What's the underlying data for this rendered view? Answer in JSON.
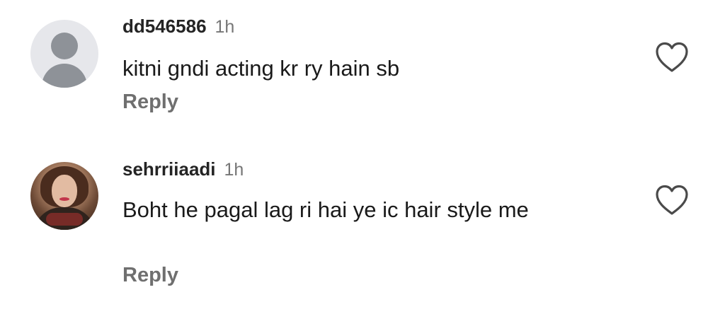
{
  "comments": [
    {
      "username": "dd546586",
      "time": "1h",
      "text": "kitni gndi acting kr ry hain sb",
      "reply_label": "Reply",
      "avatar_icon": "default-avatar-icon",
      "like_icon": "heart-outline-icon"
    },
    {
      "username": "sehrriiaadi",
      "time": "1h",
      "text": "Boht he pagal lag ri hai ye ic hair style me",
      "reply_label": "Reply",
      "avatar_icon": "profile-photo",
      "like_icon": "heart-outline-icon"
    }
  ],
  "colors": {
    "username": "#242424",
    "timestamp": "#767676",
    "reply": "#6f6f6f",
    "icon": "#4a4a4a",
    "default_avatar_bg": "#e6e7eb",
    "default_avatar_fg": "#8e9298"
  }
}
